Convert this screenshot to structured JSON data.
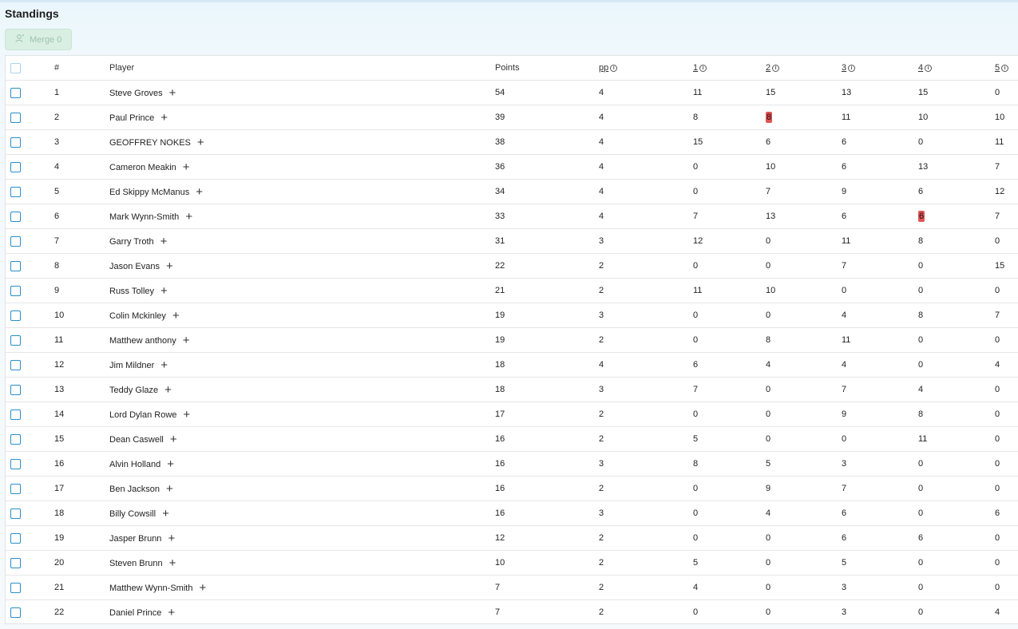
{
  "title": "Standings",
  "merge_button": {
    "label": "Merge 0",
    "icon": "user-merge-icon"
  },
  "colors": {
    "accent": "#2a8ec7",
    "highlight": "#e05555",
    "merge_bg": "#d9efe2"
  },
  "columns": [
    "#",
    "Player",
    "Points",
    "pp",
    "1",
    "2",
    "3",
    "4",
    "5"
  ],
  "rows": [
    {
      "rank": "1",
      "player": "Steve Groves",
      "points": "54",
      "pp": "4",
      "r1": "11",
      "r2": "15",
      "r3": "13",
      "r4": "15",
      "r5": "0"
    },
    {
      "rank": "2",
      "player": "Paul Prince",
      "points": "39",
      "pp": "4",
      "r1": "8",
      "r2": "8",
      "r3": "11",
      "r4": "10",
      "r5": "10"
    },
    {
      "rank": "3",
      "player": "GEOFFREY NOKES",
      "points": "38",
      "pp": "4",
      "r1": "15",
      "r2": "6",
      "r3": "6",
      "r4": "0",
      "r5": "11"
    },
    {
      "rank": "4",
      "player": "Cameron Meakin",
      "points": "36",
      "pp": "4",
      "r1": "0",
      "r2": "10",
      "r3": "6",
      "r4": "13",
      "r5": "7"
    },
    {
      "rank": "5",
      "player": "Ed Skippy McManus",
      "points": "34",
      "pp": "4",
      "r1": "0",
      "r2": "7",
      "r3": "9",
      "r4": "6",
      "r5": "12"
    },
    {
      "rank": "6",
      "player": "Mark Wynn-Smith",
      "points": "33",
      "pp": "4",
      "r1": "7",
      "r2": "13",
      "r3": "6",
      "r4": "6",
      "r5": "7"
    },
    {
      "rank": "7",
      "player": "Garry Troth",
      "points": "31",
      "pp": "3",
      "r1": "12",
      "r2": "0",
      "r3": "11",
      "r4": "8",
      "r5": "0"
    },
    {
      "rank": "8",
      "player": "Jason Evans",
      "points": "22",
      "pp": "2",
      "r1": "0",
      "r2": "0",
      "r3": "7",
      "r4": "0",
      "r5": "15"
    },
    {
      "rank": "9",
      "player": "Russ Tolley",
      "points": "21",
      "pp": "2",
      "r1": "11",
      "r2": "10",
      "r3": "0",
      "r4": "0",
      "r5": "0"
    },
    {
      "rank": "10",
      "player": "Colin Mckinley",
      "points": "19",
      "pp": "3",
      "r1": "0",
      "r2": "0",
      "r3": "4",
      "r4": "8",
      "r5": "7"
    },
    {
      "rank": "11",
      "player": "Matthew anthony",
      "points": "19",
      "pp": "2",
      "r1": "0",
      "r2": "8",
      "r3": "11",
      "r4": "0",
      "r5": "0"
    },
    {
      "rank": "12",
      "player": "Jim Mildner",
      "points": "18",
      "pp": "4",
      "r1": "6",
      "r2": "4",
      "r3": "4",
      "r4": "0",
      "r5": "4"
    },
    {
      "rank": "13",
      "player": "Teddy Glaze",
      "points": "18",
      "pp": "3",
      "r1": "7",
      "r2": "0",
      "r3": "7",
      "r4": "4",
      "r5": "0"
    },
    {
      "rank": "14",
      "player": "Lord Dylan Rowe",
      "points": "17",
      "pp": "2",
      "r1": "0",
      "r2": "0",
      "r3": "9",
      "r4": "8",
      "r5": "0"
    },
    {
      "rank": "15",
      "player": "Dean Caswell",
      "points": "16",
      "pp": "2",
      "r1": "5",
      "r2": "0",
      "r3": "0",
      "r4": "11",
      "r5": "0"
    },
    {
      "rank": "16",
      "player": "Alvin Holland",
      "points": "16",
      "pp": "3",
      "r1": "8",
      "r2": "5",
      "r3": "3",
      "r4": "0",
      "r5": "0"
    },
    {
      "rank": "17",
      "player": "Ben Jackson",
      "points": "16",
      "pp": "2",
      "r1": "0",
      "r2": "9",
      "r3": "7",
      "r4": "0",
      "r5": "0"
    },
    {
      "rank": "18",
      "player": "Billy Cowsill",
      "points": "16",
      "pp": "3",
      "r1": "0",
      "r2": "4",
      "r3": "6",
      "r4": "0",
      "r5": "6"
    },
    {
      "rank": "19",
      "player": "Jasper Brunn",
      "points": "12",
      "pp": "2",
      "r1": "0",
      "r2": "0",
      "r3": "6",
      "r4": "6",
      "r5": "0"
    },
    {
      "rank": "20",
      "player": "Steven Brunn",
      "points": "10",
      "pp": "2",
      "r1": "5",
      "r2": "0",
      "r3": "5",
      "r4": "0",
      "r5": "0"
    },
    {
      "rank": "21",
      "player": "Matthew Wynn-Smith",
      "points": "7",
      "pp": "2",
      "r1": "4",
      "r2": "0",
      "r3": "3",
      "r4": "0",
      "r5": "0"
    },
    {
      "rank": "22",
      "player": "Daniel Prince",
      "points": "7",
      "pp": "2",
      "r1": "0",
      "r2": "0",
      "r3": "3",
      "r4": "0",
      "r5": "4"
    }
  ],
  "highlighted_cells": [
    {
      "row": 1,
      "col": "r2"
    },
    {
      "row": 5,
      "col": "r4"
    }
  ],
  "add_icon": "plus-icon",
  "info_icon": "info-icon"
}
